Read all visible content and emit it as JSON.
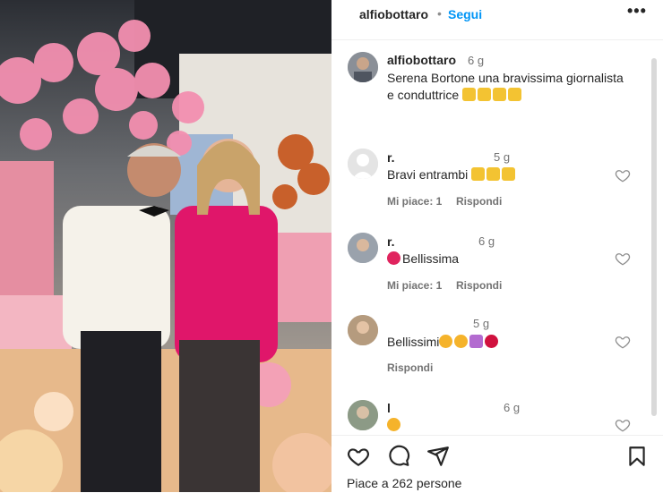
{
  "post": {
    "username": "alfiobottaro",
    "separator": "•",
    "follow_label": "Segui",
    "more_label": "•••"
  },
  "caption": {
    "username": "alfiobottaro",
    "ago": "6 g",
    "text": "Serena Bortone una bravissima giornalista e conduttrice"
  },
  "comments": [
    {
      "username": "r.",
      "ago": "5 g",
      "text": "Bravi entrambi",
      "likes": "Mi piace: 1",
      "reply": "Rispondi"
    },
    {
      "username": "r.",
      "ago": "6 g",
      "text": "Bellissima",
      "likes": "Mi piace: 1",
      "reply": "Rispondi"
    },
    {
      "username": "",
      "ago": "5 g",
      "text": "Bellissimi",
      "reply": "Rispondi"
    },
    {
      "username": "l",
      "ago": "6 g",
      "text": ""
    }
  ],
  "footer": {
    "likes_text": "Piace a 262 persone"
  },
  "colors": {
    "accent": "#0095f6",
    "muted": "#737373",
    "blazer": "#e0166a",
    "wall": "#f1a8b5"
  },
  "icons": [
    "heart-icon",
    "comment-icon",
    "share-icon",
    "bookmark-icon",
    "more-icon"
  ]
}
